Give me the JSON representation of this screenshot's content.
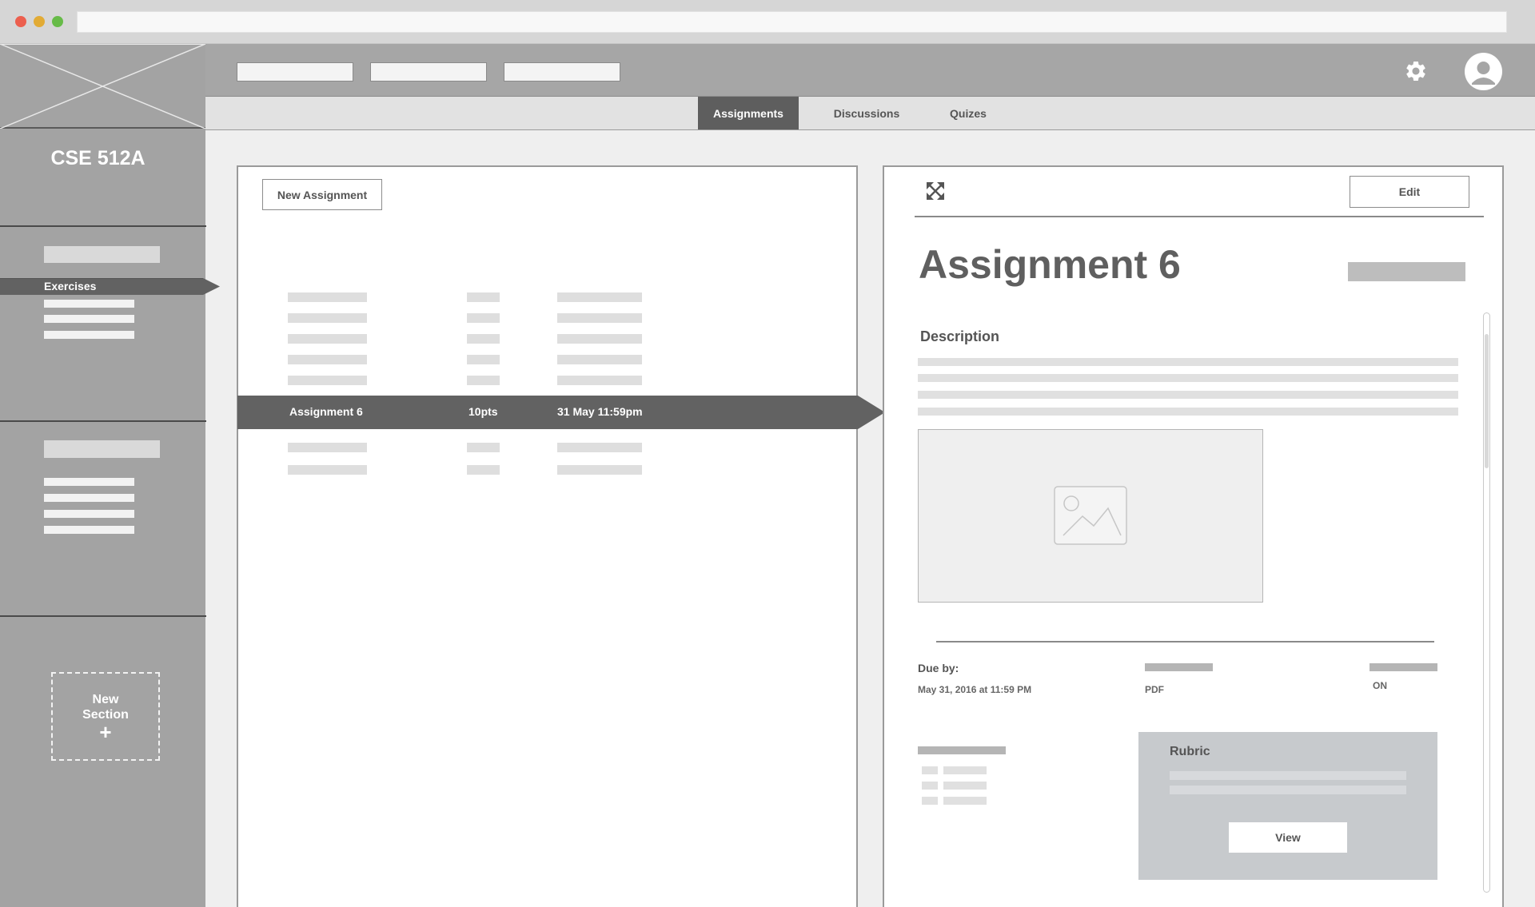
{
  "sidebar": {
    "course_title": "CSE 512A",
    "active_item": "Exercises",
    "new_section_line1": "New",
    "new_section_line2": "Section",
    "new_section_plus": "+"
  },
  "header": {
    "settings_icon": "gear-icon",
    "avatar_icon": "user-avatar-icon"
  },
  "tabs": [
    {
      "label": "Assignments",
      "active": true
    },
    {
      "label": "Discussions",
      "active": false
    },
    {
      "label": "Quizes",
      "active": false
    }
  ],
  "list": {
    "new_button": "New Assignment",
    "selected": {
      "name": "Assignment 6",
      "points": "10pts",
      "due": "31 May 11:59pm"
    }
  },
  "detail": {
    "edit_button": "Edit",
    "title": "Assignment 6",
    "description_heading": "Description",
    "due_label": "Due by:",
    "due_value": "May 31, 2016  at 11:59 PM",
    "format_value": "PDF",
    "toggle_value": "ON",
    "rubric_title": "Rubric",
    "view_button": "View"
  },
  "colors": {
    "sidebar": "#a3a3a3",
    "header": "#a6a6a6",
    "selected": "#626262",
    "active_tab": "#5e5e5e",
    "rubric": "#c7cacd"
  }
}
